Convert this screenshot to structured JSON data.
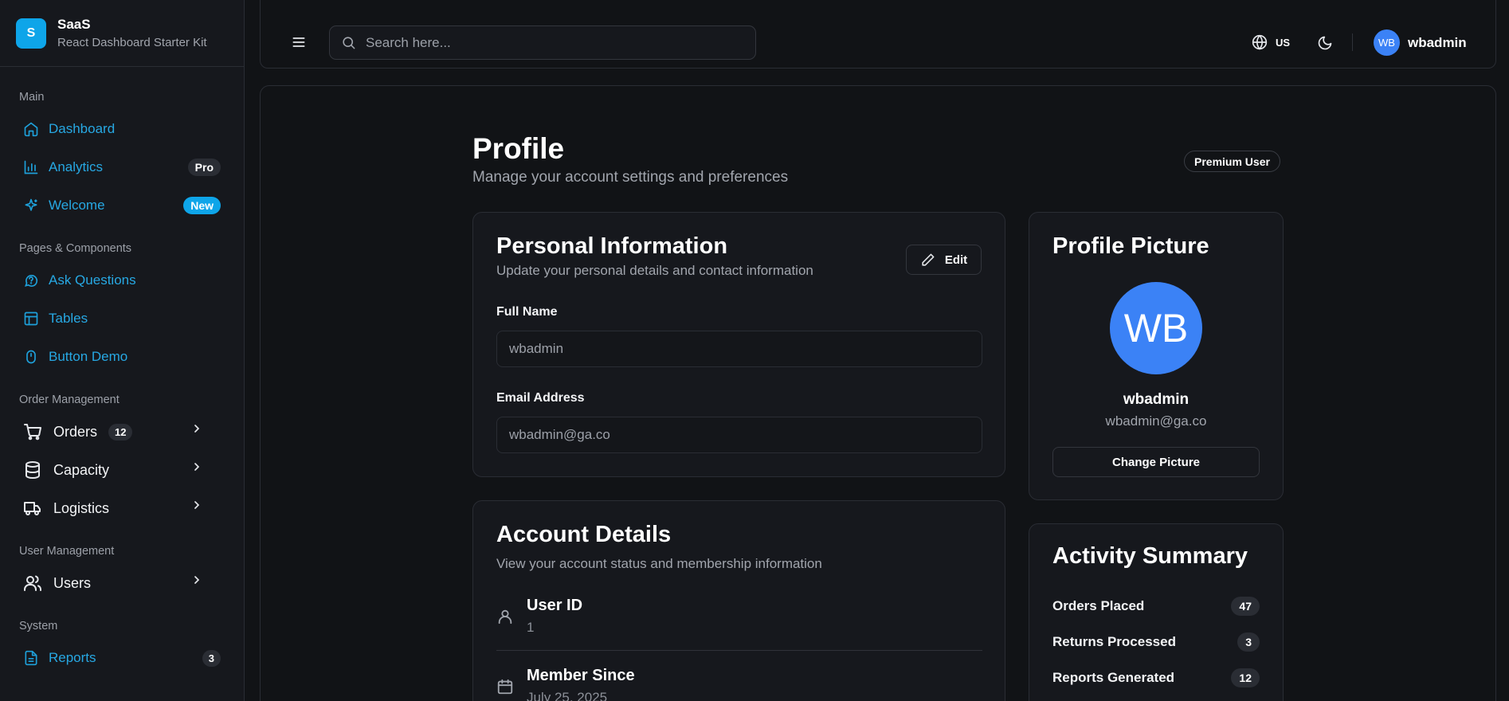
{
  "brand": {
    "logo_letter": "S",
    "name": "SaaS",
    "subtitle": "React Dashboard Starter Kit"
  },
  "sidebar": {
    "sections": {
      "main": "Main",
      "pages": "Pages & Components",
      "orders": "Order Management",
      "users": "User Management",
      "system": "System"
    },
    "items": {
      "dashboard": {
        "label": "Dashboard",
        "icon": "home-icon"
      },
      "analytics": {
        "label": "Analytics",
        "badge": "Pro",
        "icon": "bar-chart-icon"
      },
      "welcome": {
        "label": "Welcome",
        "badge": "New",
        "icon": "sparkles-icon"
      },
      "ask": {
        "label": "Ask Questions",
        "icon": "help-circle-icon"
      },
      "tables": {
        "label": "Tables",
        "icon": "table-icon"
      },
      "buttons": {
        "label": "Button Demo",
        "icon": "mouse-icon"
      },
      "orders": {
        "label": "Orders",
        "count": "12",
        "icon": "cart-icon"
      },
      "capacity": {
        "label": "Capacity",
        "icon": "database-icon"
      },
      "logistics": {
        "label": "Logistics",
        "icon": "truck-icon"
      },
      "users": {
        "label": "Users",
        "icon": "users-icon"
      },
      "reports": {
        "label": "Reports",
        "count": "3",
        "icon": "file-icon"
      }
    }
  },
  "header": {
    "search_placeholder": "Search here...",
    "locale": "US",
    "user": {
      "initials": "WB",
      "name": "wbadmin"
    }
  },
  "page": {
    "title": "Profile",
    "subtitle": "Manage your account settings and preferences",
    "badge": "Premium User"
  },
  "personal": {
    "title": "Personal Information",
    "subtitle": "Update your personal details and contact information",
    "edit_label": "Edit",
    "full_name_label": "Full Name",
    "full_name_value": "wbadmin",
    "email_label": "Email Address",
    "email_value": "wbadmin@ga.co"
  },
  "picture": {
    "title": "Profile Picture",
    "initials": "WB",
    "name": "wbadmin",
    "email": "wbadmin@ga.co",
    "change_label": "Change Picture"
  },
  "account": {
    "title": "Account Details",
    "subtitle": "View your account status and membership information",
    "user_id_label": "User ID",
    "user_id_value": "1",
    "member_since_label": "Member Since",
    "member_since_value": "July 25, 2025"
  },
  "activity": {
    "title": "Activity Summary",
    "items": [
      {
        "label": "Orders Placed",
        "value": "47"
      },
      {
        "label": "Returns Processed",
        "value": "3"
      },
      {
        "label": "Reports Generated",
        "value": "12"
      }
    ]
  },
  "colors": {
    "accent": "#0ea5e9",
    "avatar": "#3b82f6",
    "background": "#111316",
    "card": "#16181d"
  }
}
